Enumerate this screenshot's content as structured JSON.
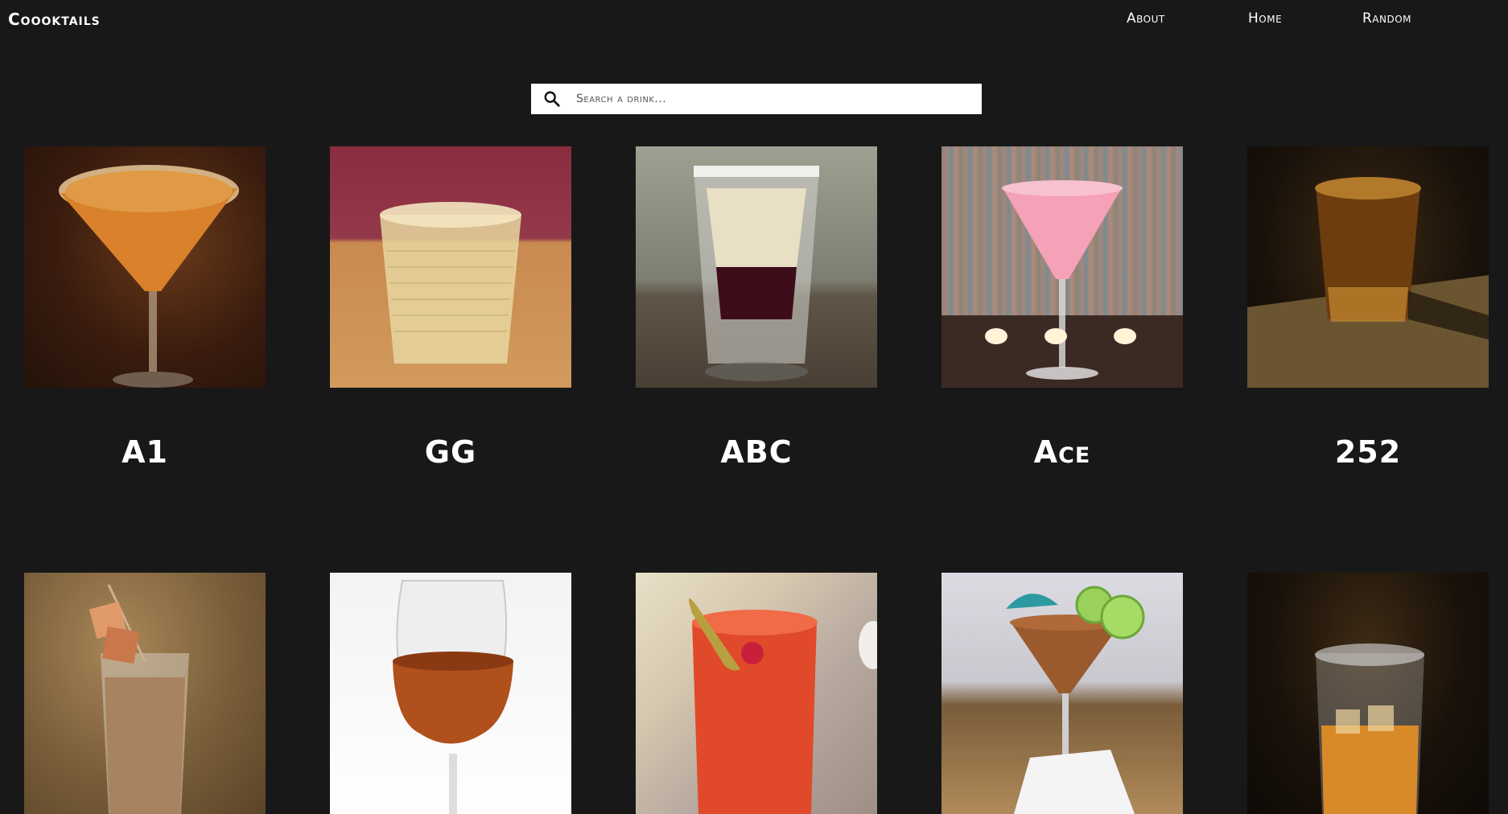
{
  "app": {
    "brand": "Coooktails"
  },
  "nav": {
    "about": "About",
    "home": "Home",
    "random": "Random"
  },
  "search": {
    "placeholder": "Search a drink...",
    "value": ""
  },
  "drinks": [
    {
      "name": "A1"
    },
    {
      "name": "GG"
    },
    {
      "name": "ABC"
    },
    {
      "name": "Ace"
    },
    {
      "name": "252"
    },
    {
      "name": ""
    },
    {
      "name": ""
    },
    {
      "name": ""
    },
    {
      "name": ""
    },
    {
      "name": ""
    }
  ],
  "colors": {
    "background": "#181818",
    "text": "#ffffff",
    "search_bg": "#ffffff"
  }
}
